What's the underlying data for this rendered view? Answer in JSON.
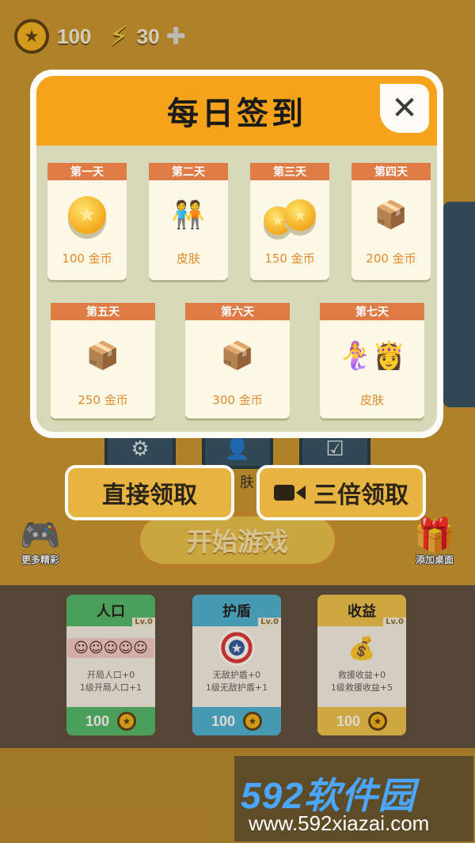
{
  "hud": {
    "coins": "100",
    "energy": "30"
  },
  "background": {
    "tile_label": "肤",
    "start_button": "开始游戏",
    "more_label": "更多精彩",
    "desktop_label": "添加桌面",
    "upgrades": [
      {
        "title": "人口",
        "level": "Lv.0",
        "line1": "开局人口+0",
        "line2": "1级开局人口+1",
        "price": "100",
        "color": "#4fb96b"
      },
      {
        "title": "护盾",
        "level": "Lv.0",
        "line1": "无敌护盾+0",
        "line2": "1级无敌护盾+1",
        "price": "100",
        "color": "#4ab2d6"
      },
      {
        "title": "收益",
        "level": "Lv.0",
        "line1": "救援收益+0",
        "line2": "1级救援收益+5",
        "price": "100",
        "color": "#f0c34a"
      }
    ]
  },
  "dialog": {
    "title": "每日签到",
    "days": [
      {
        "tag": "第一天",
        "reward": "100 金币"
      },
      {
        "tag": "第二天",
        "reward": "皮肤"
      },
      {
        "tag": "第三天",
        "reward": "150 金币"
      },
      {
        "tag": "第四天",
        "reward": "200 金币"
      },
      {
        "tag": "第五天",
        "reward": "250 金币"
      },
      {
        "tag": "第六天",
        "reward": "300 金币"
      },
      {
        "tag": "第七天",
        "reward": "皮肤"
      }
    ],
    "claim_label": "直接领取",
    "triple_label": "三倍领取"
  },
  "watermark": {
    "brand": "592软件园",
    "url": "www.592xiazai.com"
  }
}
